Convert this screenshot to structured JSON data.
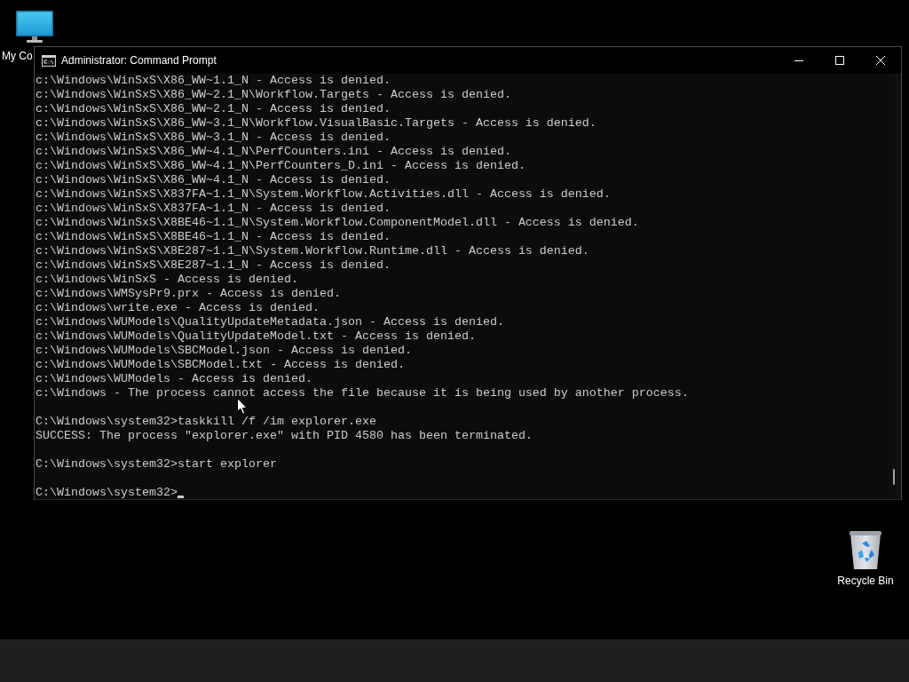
{
  "desktop": {
    "icons": [
      {
        "kind": "computer",
        "label": "My Co"
      },
      {
        "kind": "recycle-bin",
        "label": "Recycle Bin"
      }
    ]
  },
  "window": {
    "title": "Administrator: Command Prompt",
    "console": {
      "blocks": [
        {
          "lines": [
            "c:\\Windows\\WinSxS\\X86_WW~1.1_N - Access is denied.",
            "c:\\Windows\\WinSxS\\X86_WW~2.1_N\\Workflow.Targets - Access is denied.",
            "c:\\Windows\\WinSxS\\X86_WW~2.1_N - Access is denied.",
            "c:\\Windows\\WinSxS\\X86_WW~3.1_N\\Workflow.VisualBasic.Targets - Access is denied.",
            "c:\\Windows\\WinSxS\\X86_WW~3.1_N - Access is denied.",
            "c:\\Windows\\WinSxS\\X86_WW~4.1_N\\PerfCounters.ini - Access is denied.",
            "c:\\Windows\\WinSxS\\X86_WW~4.1_N\\PerfCounters_D.ini - Access is denied.",
            "c:\\Windows\\WinSxS\\X86_WW~4.1_N - Access is denied.",
            "c:\\Windows\\WinSxS\\X837FA~1.1_N\\System.Workflow.Activities.dll - Access is denied.",
            "c:\\Windows\\WinSxS\\X837FA~1.1_N - Access is denied.",
            "c:\\Windows\\WinSxS\\X8BE46~1.1_N\\System.Workflow.ComponentModel.dll - Access is denied.",
            "c:\\Windows\\WinSxS\\X8BE46~1.1_N - Access is denied.",
            "c:\\Windows\\WinSxS\\X8E287~1.1_N\\System.Workflow.Runtime.dll - Access is denied.",
            "c:\\Windows\\WinSxS\\X8E287~1.1_N - Access is denied.",
            "c:\\Windows\\WinSxS - Access is denied.",
            "c:\\Windows\\WMSysPr9.prx - Access is denied.",
            "c:\\Windows\\write.exe - Access is denied.",
            "c:\\Windows\\WUModels\\QualityUpdateMetadata.json - Access is denied.",
            "c:\\Windows\\WUModels\\QualityUpdateModel.txt - Access is denied.",
            "c:\\Windows\\WUModels\\SBCModel.json - Access is denied.",
            "c:\\Windows\\WUModels\\SBCModel.txt - Access is denied.",
            "c:\\Windows\\WUModels - Access is denied.",
            "c:\\Windows - The process cannot access the file because it is being used by another process."
          ]
        },
        {
          "lines": [
            "C:\\Windows\\system32>taskkill /f /im explorer.exe",
            "SUCCESS: The process \"explorer.exe\" with PID 4580 has been terminated."
          ]
        },
        {
          "lines": [
            "C:\\Windows\\system32>start explorer"
          ]
        }
      ],
      "prompt": {
        "text": "C:\\Windows\\system32>",
        "caret": true
      }
    }
  }
}
